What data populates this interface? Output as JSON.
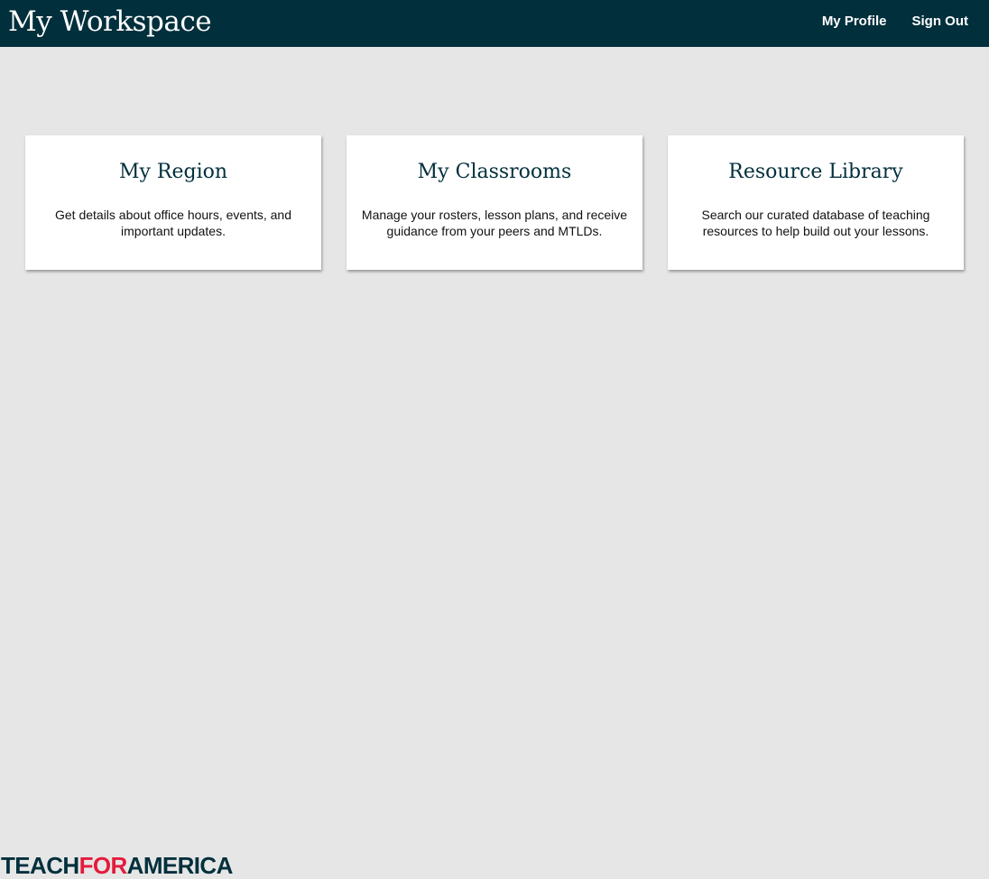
{
  "header": {
    "title": "My Workspace",
    "nav": [
      {
        "label": "My Profile"
      },
      {
        "label": "Sign Out"
      }
    ]
  },
  "cards": [
    {
      "title": "My Region",
      "description": "Get details about office hours, events, and important updates."
    },
    {
      "title": "My Classrooms",
      "description": "Manage your rosters, lesson plans, and receive guidance from your peers and MTLDs."
    },
    {
      "title": "Resource Library",
      "description": "Search our curated database of teaching resources to help build out your lessons."
    }
  ],
  "footer": {
    "logo": {
      "part1": "TEACH",
      "part2": "FOR",
      "part3": "AMERICA"
    }
  },
  "colors": {
    "header_bg": "#012f3c",
    "page_bg": "#e6e6e6",
    "card_bg": "#ffffff",
    "logo_dark": "#012f3c",
    "logo_accent": "#e31c3d"
  }
}
